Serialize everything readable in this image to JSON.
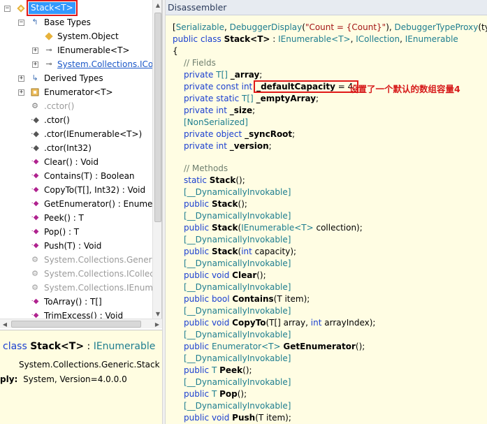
{
  "tree": {
    "selected": "Stack<T>",
    "base_types": "Base Types",
    "system_object": "System.Object",
    "ienumerable": "IEnumerable<T>",
    "sys_coll_icol": "System.Collections.ICol",
    "derived_types": "Derived Types",
    "enumerator": "Enumerator<T>",
    "cctor": ".cctor()",
    "ctor": ".ctor()",
    "ctor_ienum": ".ctor(IEnumerable<T>)",
    "ctor_int": ".ctor(Int32)",
    "clear": "Clear() : Void",
    "contains": "Contains(T) : Boolean",
    "copyto": "CopyTo(T[], Int32) : Void",
    "getenum": "GetEnumerator() : Enumer",
    "peek": "Peek() : T",
    "pop": "Pop() : T",
    "push": "Push(T) : Void",
    "sys_generic": "System.Collections.Generic",
    "sys_icollect": "System.Collections.ICollect",
    "sys_ienume": "System.Collections.IEnume",
    "toarray": "ToArray() : T[]",
    "trimexcess": "TrimExcess() : Void"
  },
  "summary": {
    "kw": "class",
    "name": "Stack<T>",
    "colon": ":",
    "base": "IEnumerable",
    "fullname": "System.Collections.Generic.Stack",
    "asm_label": "ply:",
    "asm_value": "System, Version=4.0.0.0"
  },
  "disassembler": {
    "title": "Disassembler",
    "annotation": "设置了一个默认的数组容量4",
    "attr_prefix": "[",
    "serializable": "Serializable",
    "comma1": ", ",
    "debuggerdisplay": "DebuggerDisplay",
    "dd_open": "(",
    "dd_string": "\"Count = {Count}\"",
    "dd_close": "), ",
    "debuggerproxy": "DebuggerTypeProxy",
    "proxy_tail": "(typec",
    "public": "public",
    "private": "private",
    "static": "static",
    "const": "const",
    "class": "class",
    "int": "int",
    "object": "object",
    "void": "void",
    "bool": "bool",
    "stack_name": "Stack",
    "generic_t": "<T>",
    "decl_colon": " : ",
    "ienumerable_t": "IEnumerable<T>",
    "icollection": "ICollection",
    "ienumerable": "IEnumerable",
    "comma": ", ",
    "brace": "{",
    "fields_comment": "// Fields",
    "methods_comment": "// Methods",
    "t_arr": "T[]",
    "t": "T",
    "field_array": "_array",
    "field_default": "_defaultCapacity",
    "field_default_eq": " = 4;",
    "field_empty": "_emptyArray",
    "field_size": "_size",
    "nonserialized": "[NonSerialized]",
    "field_sync": "_syncRoot",
    "field_version": "_version",
    "semi": ";",
    "dyn_invokable": "[__DynamicallyInvokable]",
    "cctor_sig": "Stack",
    "cctor_args": "();",
    "m_stack": "Stack",
    "p_empty": "();",
    "p_ienum_open": "(",
    "p_ienum_arg": "IEnumerable<T>",
    "p_ienum_close": " collection);",
    "p_int_open": "(",
    "p_int_close": " capacity);",
    "m_clear": "Clear",
    "m_contains": "Contains",
    "p_contains": "(T item);",
    "m_copyto": "CopyTo",
    "p_copyto_open": "(T[] array, ",
    "p_copyto_close": " arrayIndex);",
    "enumerator_t": "Enumerator<T>",
    "m_getenum": "GetEnumerator",
    "m_peek": "Peek",
    "m_pop": "Pop",
    "m_push": "Push",
    "p_push": "(T item);"
  },
  "colors": {
    "keyword": "#1a3fd0",
    "type": "#1d7d8f",
    "selection": "#3399ff",
    "highlight_box": "#e01818",
    "code_bg": "#fffde3"
  }
}
